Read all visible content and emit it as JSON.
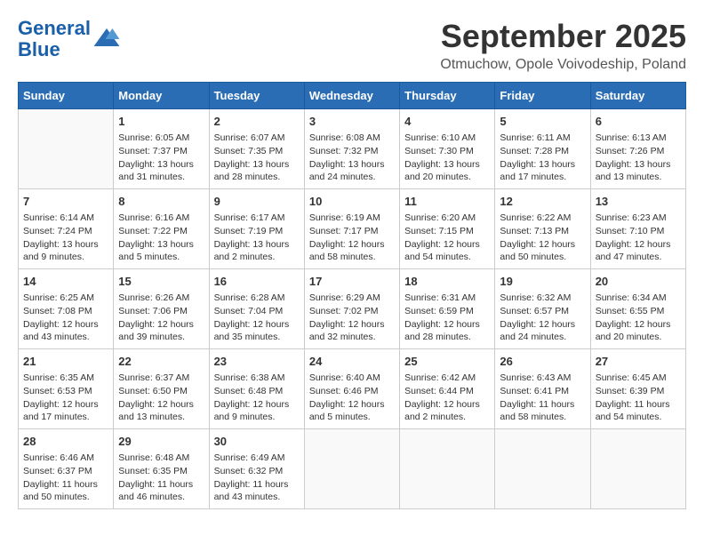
{
  "header": {
    "logo_line1": "General",
    "logo_line2": "Blue",
    "title": "September 2025",
    "subtitle": "Otmuchow, Opole Voivodeship, Poland"
  },
  "weekdays": [
    "Sunday",
    "Monday",
    "Tuesday",
    "Wednesday",
    "Thursday",
    "Friday",
    "Saturday"
  ],
  "weeks": [
    [
      {
        "day": "",
        "info": ""
      },
      {
        "day": "1",
        "info": "Sunrise: 6:05 AM\nSunset: 7:37 PM\nDaylight: 13 hours and 31 minutes."
      },
      {
        "day": "2",
        "info": "Sunrise: 6:07 AM\nSunset: 7:35 PM\nDaylight: 13 hours and 28 minutes."
      },
      {
        "day": "3",
        "info": "Sunrise: 6:08 AM\nSunset: 7:32 PM\nDaylight: 13 hours and 24 minutes."
      },
      {
        "day": "4",
        "info": "Sunrise: 6:10 AM\nSunset: 7:30 PM\nDaylight: 13 hours and 20 minutes."
      },
      {
        "day": "5",
        "info": "Sunrise: 6:11 AM\nSunset: 7:28 PM\nDaylight: 13 hours and 17 minutes."
      },
      {
        "day": "6",
        "info": "Sunrise: 6:13 AM\nSunset: 7:26 PM\nDaylight: 13 hours and 13 minutes."
      }
    ],
    [
      {
        "day": "7",
        "info": "Sunrise: 6:14 AM\nSunset: 7:24 PM\nDaylight: 13 hours and 9 minutes."
      },
      {
        "day": "8",
        "info": "Sunrise: 6:16 AM\nSunset: 7:22 PM\nDaylight: 13 hours and 5 minutes."
      },
      {
        "day": "9",
        "info": "Sunrise: 6:17 AM\nSunset: 7:19 PM\nDaylight: 13 hours and 2 minutes."
      },
      {
        "day": "10",
        "info": "Sunrise: 6:19 AM\nSunset: 7:17 PM\nDaylight: 12 hours and 58 minutes."
      },
      {
        "day": "11",
        "info": "Sunrise: 6:20 AM\nSunset: 7:15 PM\nDaylight: 12 hours and 54 minutes."
      },
      {
        "day": "12",
        "info": "Sunrise: 6:22 AM\nSunset: 7:13 PM\nDaylight: 12 hours and 50 minutes."
      },
      {
        "day": "13",
        "info": "Sunrise: 6:23 AM\nSunset: 7:10 PM\nDaylight: 12 hours and 47 minutes."
      }
    ],
    [
      {
        "day": "14",
        "info": "Sunrise: 6:25 AM\nSunset: 7:08 PM\nDaylight: 12 hours and 43 minutes."
      },
      {
        "day": "15",
        "info": "Sunrise: 6:26 AM\nSunset: 7:06 PM\nDaylight: 12 hours and 39 minutes."
      },
      {
        "day": "16",
        "info": "Sunrise: 6:28 AM\nSunset: 7:04 PM\nDaylight: 12 hours and 35 minutes."
      },
      {
        "day": "17",
        "info": "Sunrise: 6:29 AM\nSunset: 7:02 PM\nDaylight: 12 hours and 32 minutes."
      },
      {
        "day": "18",
        "info": "Sunrise: 6:31 AM\nSunset: 6:59 PM\nDaylight: 12 hours and 28 minutes."
      },
      {
        "day": "19",
        "info": "Sunrise: 6:32 AM\nSunset: 6:57 PM\nDaylight: 12 hours and 24 minutes."
      },
      {
        "day": "20",
        "info": "Sunrise: 6:34 AM\nSunset: 6:55 PM\nDaylight: 12 hours and 20 minutes."
      }
    ],
    [
      {
        "day": "21",
        "info": "Sunrise: 6:35 AM\nSunset: 6:53 PM\nDaylight: 12 hours and 17 minutes."
      },
      {
        "day": "22",
        "info": "Sunrise: 6:37 AM\nSunset: 6:50 PM\nDaylight: 12 hours and 13 minutes."
      },
      {
        "day": "23",
        "info": "Sunrise: 6:38 AM\nSunset: 6:48 PM\nDaylight: 12 hours and 9 minutes."
      },
      {
        "day": "24",
        "info": "Sunrise: 6:40 AM\nSunset: 6:46 PM\nDaylight: 12 hours and 5 minutes."
      },
      {
        "day": "25",
        "info": "Sunrise: 6:42 AM\nSunset: 6:44 PM\nDaylight: 12 hours and 2 minutes."
      },
      {
        "day": "26",
        "info": "Sunrise: 6:43 AM\nSunset: 6:41 PM\nDaylight: 11 hours and 58 minutes."
      },
      {
        "day": "27",
        "info": "Sunrise: 6:45 AM\nSunset: 6:39 PM\nDaylight: 11 hours and 54 minutes."
      }
    ],
    [
      {
        "day": "28",
        "info": "Sunrise: 6:46 AM\nSunset: 6:37 PM\nDaylight: 11 hours and 50 minutes."
      },
      {
        "day": "29",
        "info": "Sunrise: 6:48 AM\nSunset: 6:35 PM\nDaylight: 11 hours and 46 minutes."
      },
      {
        "day": "30",
        "info": "Sunrise: 6:49 AM\nSunset: 6:32 PM\nDaylight: 11 hours and 43 minutes."
      },
      {
        "day": "",
        "info": ""
      },
      {
        "day": "",
        "info": ""
      },
      {
        "day": "",
        "info": ""
      },
      {
        "day": "",
        "info": ""
      }
    ]
  ]
}
